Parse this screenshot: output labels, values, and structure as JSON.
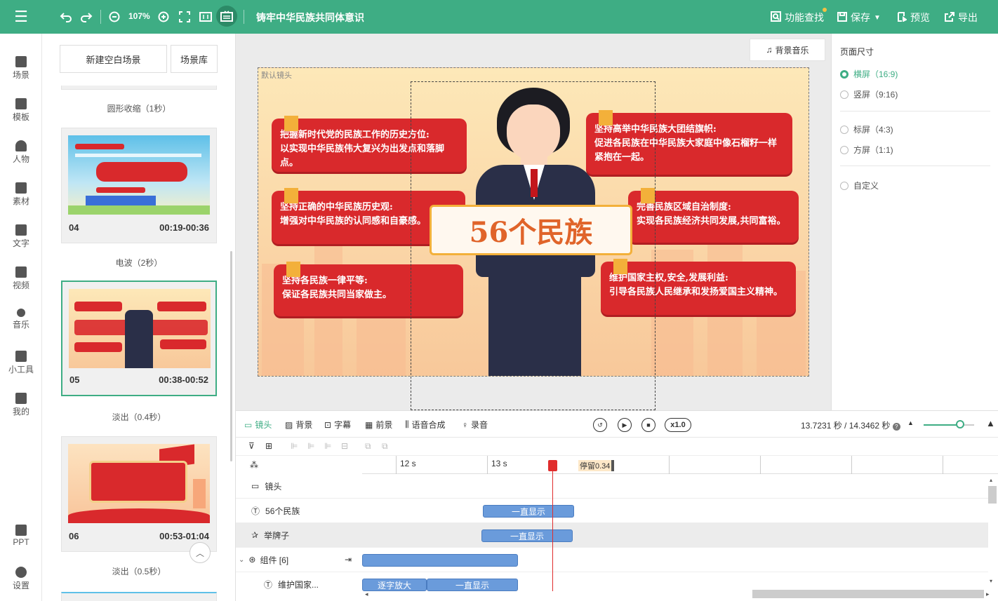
{
  "topbar": {
    "zoom": "107%",
    "title": "铸牢中华民族共同体意识",
    "feature_search": "功能查找",
    "save": "保存",
    "preview": "预览",
    "export": "导出"
  },
  "nav": [
    {
      "label": "场景",
      "icon": "scene-icon"
    },
    {
      "label": "模板",
      "icon": "template-icon"
    },
    {
      "label": "人物",
      "icon": "person-icon"
    },
    {
      "label": "素材",
      "icon": "material-icon"
    },
    {
      "label": "文字",
      "icon": "text-icon"
    },
    {
      "label": "视频",
      "icon": "video-icon"
    },
    {
      "label": "音乐",
      "icon": "music-icon"
    },
    {
      "label": "小工具",
      "icon": "toolbox-icon"
    },
    {
      "label": "我的",
      "icon": "upload-icon"
    },
    {
      "label": "PPT",
      "icon": "ppt-icon"
    },
    {
      "label": "设置",
      "icon": "gear-icon"
    }
  ],
  "scenes": {
    "new_blank": "新建空白场景",
    "library": "场景库",
    "transitions": [
      "圆形收缩（1秒）",
      "电波（2秒）",
      "淡出（0.4秒）",
      "淡出（0.5秒）"
    ],
    "cards": [
      {
        "num": "04",
        "time": "00:19-00:36"
      },
      {
        "num": "05",
        "time": "00:38-00:52"
      },
      {
        "num": "06",
        "time": "00:53-01:04"
      }
    ]
  },
  "stage": {
    "bgm": "背景音乐",
    "default_lens": "默认镜头",
    "sign": "56个民族",
    "banners": [
      {
        "l1": "把握新时代党的民族工作的历史方位:",
        "l2": "以实现中华民族伟大复兴为出发点和落脚点。"
      },
      {
        "l1": "坚持正确的中华民族历史观:",
        "l2": "增强对中华民族的认同感和自豪感。"
      },
      {
        "l1": "坚持各民族一律平等:",
        "l2": "保证各民族共同当家做主。"
      },
      {
        "l1": "坚持高举中华民族大团结旗帜:",
        "l2": "促进各民族在中华民族大家庭中像石榴籽一样",
        "l3": "紧抱在一起。"
      },
      {
        "l1": "完善民族区域自治制度:",
        "l2": "实现各民族经济共同发展,共同富裕。"
      },
      {
        "l1": "维护国家主权,安全,发展利益:",
        "l2": "引导各民族人民继承和发扬爱国主义精神。"
      }
    ]
  },
  "page_size": {
    "title": "页面尺寸",
    "options": [
      {
        "label": "横屏（16:9)",
        "selected": true
      },
      {
        "label": "竖屏（9:16)",
        "selected": false
      },
      {
        "label": "标屏（4:3)",
        "selected": false
      },
      {
        "label": "方屏（1:1)",
        "selected": false
      },
      {
        "label": "自定义",
        "selected": false
      }
    ]
  },
  "timeline": {
    "tabs": [
      "镜头",
      "背景",
      "字幕",
      "前景",
      "语音合成",
      "录音"
    ],
    "speed": "x1.0",
    "time": "13.7231 秒 / 14.3462 秒",
    "ticks": [
      "12 s",
      "13 s"
    ],
    "stay": "停留0.34",
    "rows": [
      {
        "label": "镜头"
      },
      {
        "label": "56个民族",
        "seg": "一直显示"
      },
      {
        "label": "举牌子",
        "seg": "一直显示"
      },
      {
        "label": "组件 [6]"
      },
      {
        "label": "维护国家...",
        "seg1": "逐字放大",
        "seg2": "一直显示"
      }
    ]
  },
  "colors": {
    "brand": "#3ead84",
    "banner": "#d9292c",
    "segment": "#6a9bdb",
    "playhead": "#e02d2d"
  }
}
